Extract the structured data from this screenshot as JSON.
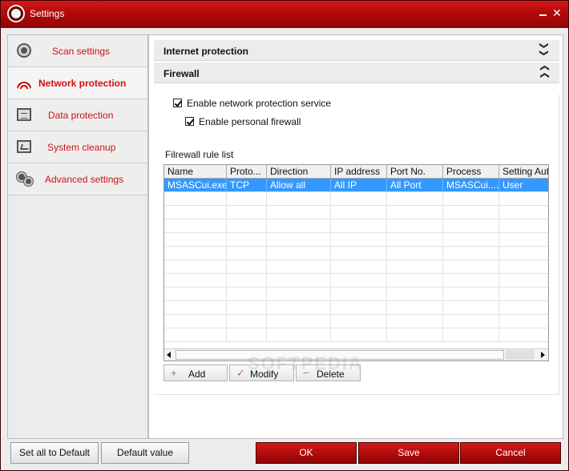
{
  "window": {
    "title": "Settings",
    "close_glyph": "✕"
  },
  "sidebar": {
    "items": [
      {
        "label": "Scan settings",
        "icon": "gear-icon"
      },
      {
        "label": "Network protection",
        "icon": "network-icon",
        "active": true
      },
      {
        "label": "Data protection",
        "icon": "document-icon"
      },
      {
        "label": "System cleanup",
        "icon": "monitor-icon"
      },
      {
        "label": "Advanced settings",
        "icon": "gears-icon"
      }
    ]
  },
  "sections": {
    "internet": {
      "title": "Internet protection",
      "chevron": "❯❯"
    },
    "firewall": {
      "title": "Firewall",
      "chevron": "❯❯"
    }
  },
  "firewall": {
    "enable_network": "Enable network protection service",
    "enable_firewall": "Enable personal firewall",
    "list_label": "Filrewall rule list"
  },
  "table": {
    "columns": [
      "Name",
      "Proto...",
      "Direction",
      "IP address",
      "Port No.",
      "Process",
      "Setting Aut"
    ],
    "rows": [
      [
        "MSASCui.exe",
        "TCP",
        "Allow all",
        "All IP",
        "All Port",
        "MSASCui....",
        "User"
      ]
    ]
  },
  "rule_buttons": {
    "add": {
      "label": "Add",
      "glyph": "+"
    },
    "modify": {
      "label": "Modify",
      "glyph": "✓"
    },
    "delete": {
      "label": "Delete",
      "glyph": "−"
    }
  },
  "footer": {
    "set_all_default": "Set all to Default",
    "default_value": "Default value",
    "ok": "OK",
    "save": "Save",
    "cancel": "Cancel"
  },
  "colors": {
    "accent": "#c00000",
    "selection": "#3399ff"
  }
}
